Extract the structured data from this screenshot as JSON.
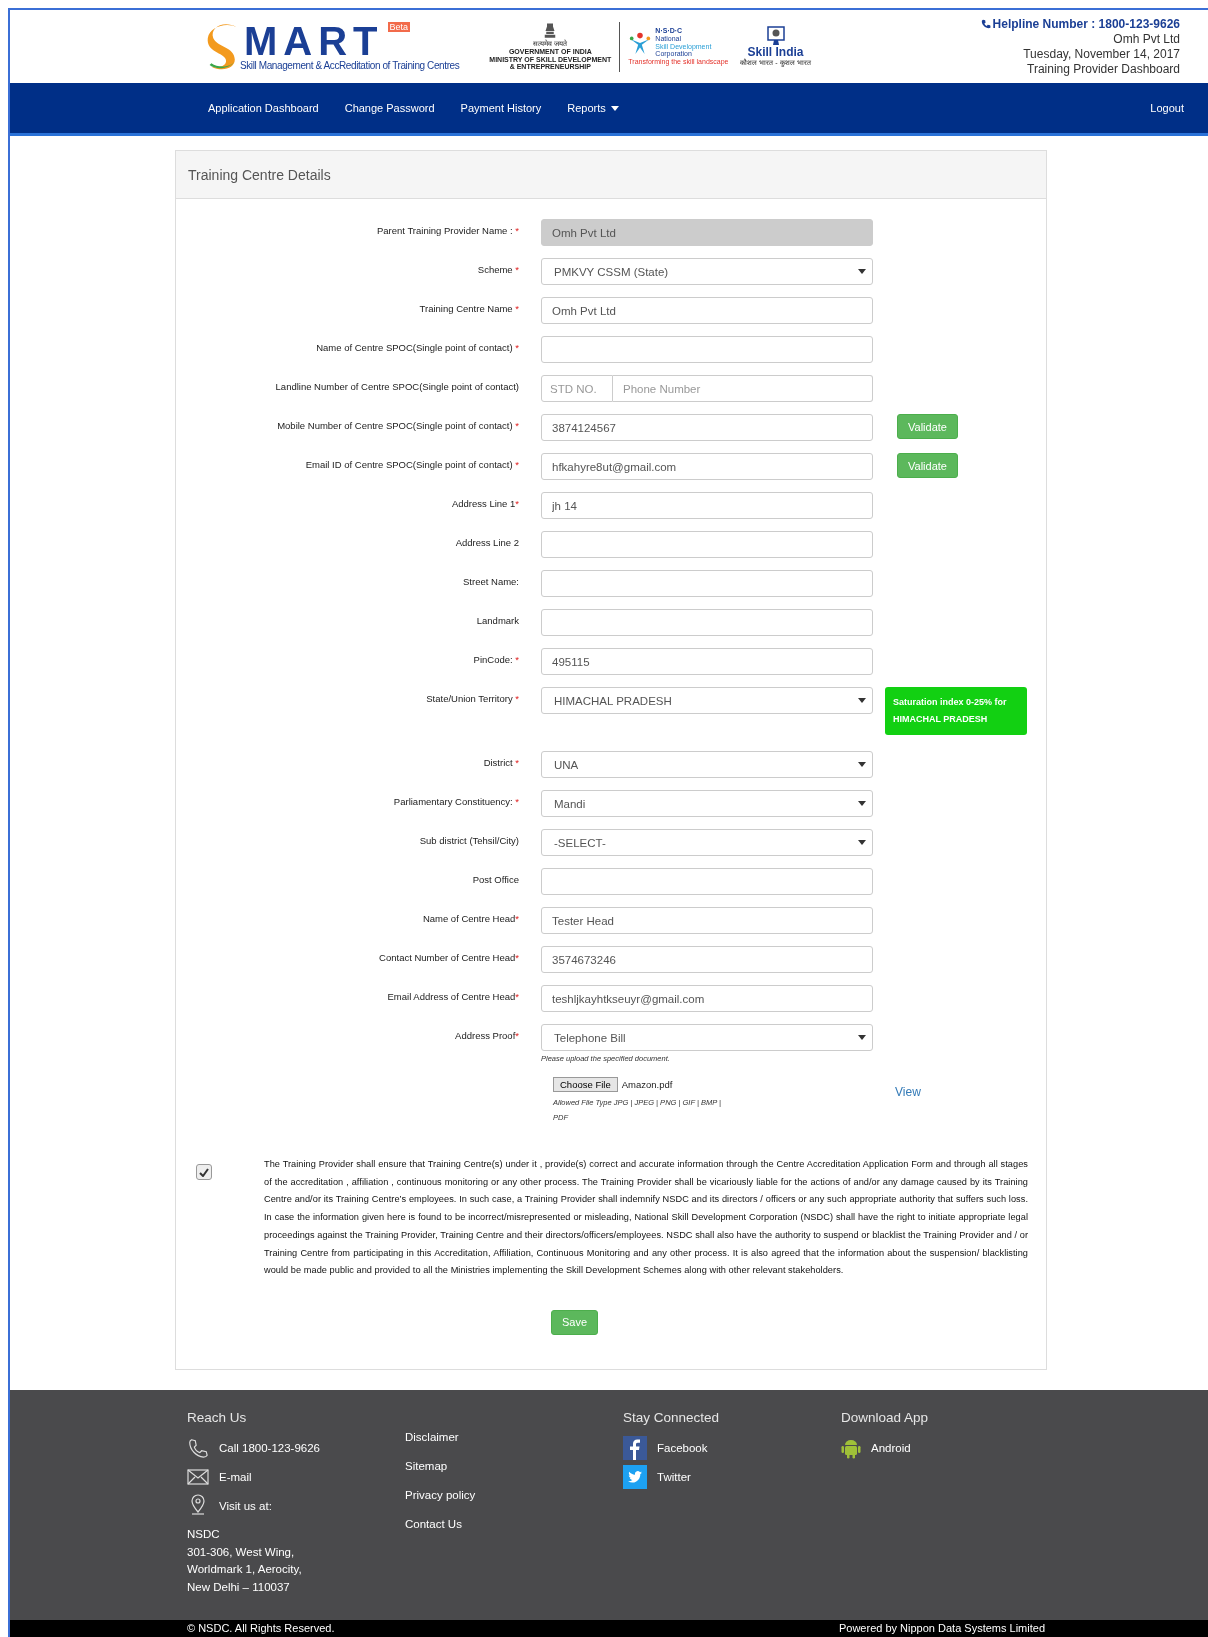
{
  "header": {
    "logo": {
      "wordmark": "MART",
      "badge": "Beta",
      "tagline": "Skill Management & AccReditation of Training Centres"
    },
    "ministry": {
      "motto": "सत्यमेव जयते",
      "lines": [
        "GOVERNMENT OF INDIA",
        "MINISTRY OF SKILL DEVELOPMENT",
        "& ENTREPRENEURSHIP"
      ]
    },
    "nsdc": {
      "acronym": "N·S·D·C",
      "lines": [
        "National",
        "Skill Development",
        "Corporation"
      ],
      "slogan": "Transforming the skill landscape"
    },
    "skill_india": {
      "title": "Skill India",
      "slogan": "कौशल भारत - कुशल भारत"
    },
    "helpline": "Helpline Number : 1800-123-9626",
    "user": "Omh Pvt Ltd",
    "date": "Tuesday, November 14, 2017",
    "role": "Training Provider Dashboard"
  },
  "nav": {
    "items": [
      {
        "label": "Application Dashboard",
        "dropdown": false
      },
      {
        "label": "Change Password",
        "dropdown": false
      },
      {
        "label": "Payment History",
        "dropdown": false
      },
      {
        "label": "Reports",
        "dropdown": true
      }
    ],
    "logout": "Logout"
  },
  "panel": {
    "title": "Training Centre Details",
    "fields": [
      {
        "kind": "readonly",
        "label": "Parent Training Provider Name : ",
        "required_mark": "*",
        "value": "Omh Pvt Ltd"
      },
      {
        "kind": "select",
        "label": "Scheme ",
        "required_mark": "*",
        "value": "PMKVY CSSM (State)"
      },
      {
        "kind": "text",
        "label": "Training Centre Name ",
        "required_mark": "*",
        "value": "Omh Pvt Ltd"
      },
      {
        "kind": "text",
        "label": "Name of Centre SPOC(Single point of contact) ",
        "required_mark": "*"
      },
      {
        "kind": "phone",
        "label": "Landline Number of Centre SPOC(Single point of contact)",
        "std_placeholder": "STD NO.",
        "placeholder": "Phone Number"
      },
      {
        "kind": "text",
        "label": "Mobile Number of Centre SPOC(Single point of contact) ",
        "required_mark": "*",
        "value": "3874124567",
        "action": "Validate"
      },
      {
        "kind": "text",
        "label": "Email ID of Centre SPOC(Single point of contact) ",
        "required_mark": "*",
        "value": "hfkahyre8ut@gmail.com",
        "action": "Validate"
      },
      {
        "kind": "text",
        "label": "Address Line 1",
        "required_mark": "*",
        "value": "jh 14"
      },
      {
        "kind": "text",
        "label": "Address Line 2"
      },
      {
        "kind": "text",
        "label": "Street Name:"
      },
      {
        "kind": "text",
        "label": "Landmark"
      },
      {
        "kind": "text",
        "label": "PinCode: ",
        "required_mark": "*",
        "value": "495115"
      },
      {
        "kind": "select",
        "label": "State/Union Territory ",
        "required_mark": "*",
        "value": "HIMACHAL PRADESH",
        "notice": "Saturation index 0-25% for HIMACHAL PRADESH"
      },
      {
        "kind": "select",
        "label": "District ",
        "required_mark": "*",
        "value": "UNA"
      },
      {
        "kind": "select",
        "label": "Parliamentary Constituency: ",
        "required_mark": "*",
        "value": "Mandi"
      },
      {
        "kind": "select",
        "label": "Sub district (Tehsil/City)",
        "value": "-SELECT-"
      },
      {
        "kind": "text",
        "label": "Post Office"
      },
      {
        "kind": "text",
        "label": "Name of Centre Head",
        "required_mark": "*",
        "value": "Tester Head"
      },
      {
        "kind": "text",
        "label": "Contact Number of Centre Head",
        "required_mark": "*",
        "value": "3574673246"
      },
      {
        "kind": "text",
        "label": "Email Address of Centre Head",
        "required_mark": "*",
        "value": "teshljkayhtkseuyr@gmail.com"
      },
      {
        "kind": "select",
        "label": "Address Proof",
        "required_mark": "*",
        "value": "Telephone Bill",
        "hint": "Please upload the specified document."
      }
    ],
    "upload": {
      "button": "Choose File",
      "file": "Amazon.pdf",
      "allowed": [
        "Allowed File Type JPG | JPEG | PNG | GIF | BMP |",
        "PDF"
      ],
      "view": "View"
    },
    "consent": {
      "checked": true,
      "text": "The Training Provider shall ensure that Training Centre(s) under it , provide(s) correct and accurate information through the Centre Accreditation Application Form and through all stages of the accreditation , affiliation , continuous monitoring or any other process. The Training Provider shall be vicariously liable for the actions of and/or any damage caused by its Training Centre and/or its Training Centre’s employees. In such case, a Training Provider shall indemnify NSDC and its directors / officers or any such appropriate authority that suffers such loss. In case the information given here is found to be incorrect/misrepresented or misleading, National Skill Development Corporation (NSDC) shall have the right to initiate appropriate legal proceedings against the Training Provider, Training Centre and their directors/officers/employees. NSDC shall also have the authority to suspend or blacklist the Training Provider and / or Training Centre from participating in this Accreditation, Affiliation, Continuous Monitoring and any other process. It is also agreed that the information about the suspension/ blacklisting would be made public and provided to all the Ministries implementing the Skill Development Schemes along with other relevant stakeholders."
    },
    "save": "Save"
  },
  "footer": {
    "reach": {
      "title": "Reach Us",
      "items": [
        {
          "kind": "phone",
          "label": "Call 1800-123-9626"
        },
        {
          "kind": "mail",
          "label": "E-mail"
        },
        {
          "kind": "pin",
          "label": "Visit us at:"
        }
      ],
      "address": [
        "NSDC",
        "301-306, West Wing,",
        "Worldmark 1, Aerocity,",
        "New Delhi – 110037"
      ]
    },
    "links": [
      "Disclaimer",
      "Sitemap",
      "Privacy policy",
      "Contact Us"
    ],
    "social": {
      "title": "Stay Connected",
      "items": [
        {
          "kind": "facebook",
          "label": "Facebook"
        },
        {
          "kind": "twitter",
          "label": "Twitter"
        }
      ]
    },
    "app": {
      "title": "Download App",
      "items": [
        {
          "kind": "android",
          "label": "Android"
        }
      ]
    },
    "copyright": "© NSDC. All Rights Reserved.",
    "powered": "Powered by Nippon Data Systems Limited"
  }
}
